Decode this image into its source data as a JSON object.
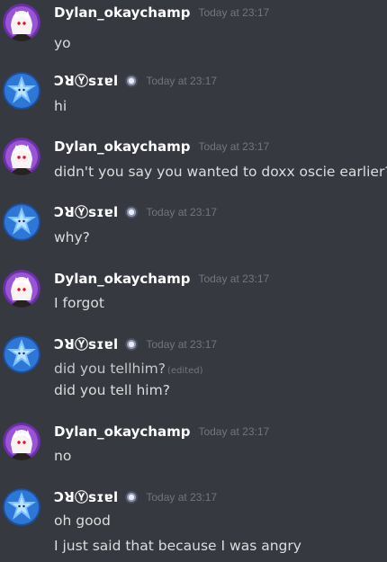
{
  "channel": {
    "messages": [
      {
        "author": "Dylan_okaychamp",
        "timestamp": "Today at 23:17",
        "lines": [
          "yo"
        ]
      },
      {
        "author": "ƆꓤⓎsɪɐl",
        "timestamp": "Today at 23:17",
        "lines": [
          "hi"
        ]
      },
      {
        "author": "Dylan_okaychamp",
        "timestamp": "Today at 23:17",
        "lines": [
          "didn't you say you wanted to doxx oscie earlier?"
        ]
      },
      {
        "author": "ƆꓤⓎsɪɐl",
        "timestamp": "Today at 23:17",
        "lines": [
          "why?"
        ]
      },
      {
        "author": "Dylan_okaychamp",
        "timestamp": "Today at 23:17",
        "lines": [
          "I forgot"
        ]
      },
      {
        "author": "ƆꓤⓎsɪɐl",
        "timestamp": "Today at 23:17",
        "lines": [
          "did you tellhim?",
          "did you tell him?"
        ],
        "edited": "(edited)"
      },
      {
        "author": "Dylan_okaychamp",
        "timestamp": "Today at 23:17",
        "lines": [
          "no"
        ]
      },
      {
        "author": "ƆꓤⓎsɪɐl",
        "timestamp": "Today at 23:17",
        "lines": [
          "oh good",
          "I just said that because I was angry"
        ]
      }
    ]
  },
  "colors": {
    "background": "#36393f",
    "username": "#ffffff",
    "timestamp": "#72767d",
    "message_text": "#dcddde"
  },
  "icons": {
    "user_badge": "server-badge-icon",
    "dylan_avatar": "anime-avatar-icon",
    "crystal_avatar": "blue-star-avatar-icon"
  }
}
